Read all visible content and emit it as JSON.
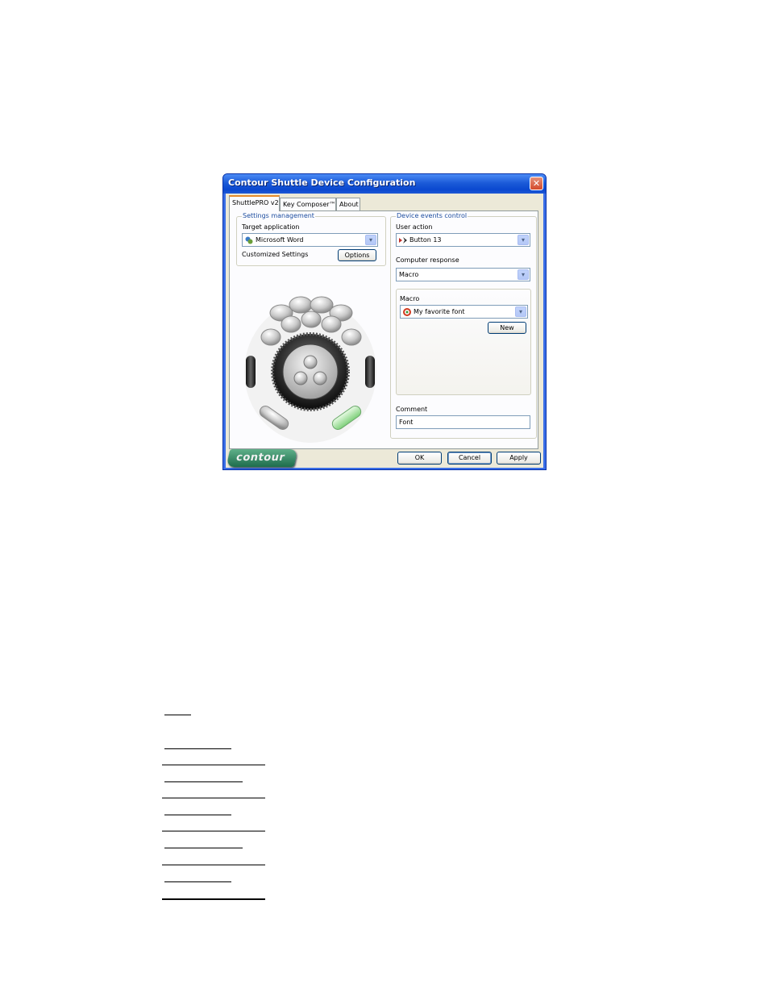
{
  "window": {
    "title": "Contour Shuttle Device Configuration",
    "close_glyph": "✕"
  },
  "tabs": [
    {
      "label": "ShuttlePRO v2",
      "active": true
    },
    {
      "label": "Key Composer™",
      "active": false
    },
    {
      "label": "About",
      "active": false
    }
  ],
  "settings_management": {
    "group_label": "Settings management",
    "target_application_label": "Target application",
    "target_application_value": "Microsoft Word",
    "target_application_icon": "word-app-icon",
    "customized_settings_label": "Customized Settings",
    "options_button": "Options"
  },
  "device_events": {
    "group_label": "Device events control",
    "user_action_label": "User action",
    "user_action_value": "Button 13",
    "user_action_icon": "button-event-icon",
    "computer_response_label": "Computer response",
    "computer_response_value": "Macro",
    "macro": {
      "label": "Macro",
      "value": "My favorite font",
      "icon": "macro-icon",
      "new_button": "New"
    },
    "comment_label": "Comment",
    "comment_value": "Font"
  },
  "footer": {
    "logo_text": "contour",
    "ok_button": "OK",
    "cancel_button": "Cancel",
    "apply_button": "Apply"
  },
  "colors": {
    "title_bar": "#0a48d0",
    "dialog_face": "#ece9d8",
    "group_label": "#1e4ea0",
    "highlighted_button": "#a8e6a0"
  }
}
